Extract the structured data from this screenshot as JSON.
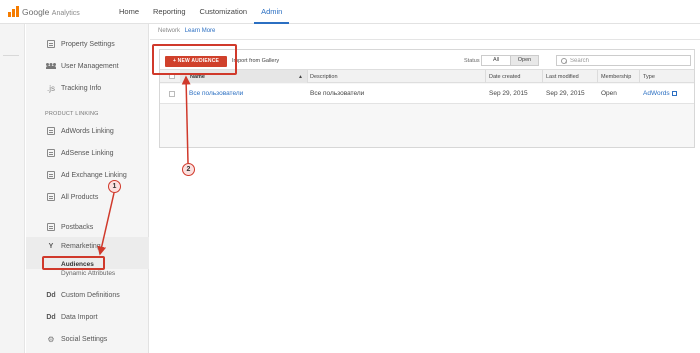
{
  "app": {
    "logo_brand": "Google",
    "logo_product": "Analytics"
  },
  "topnav": [
    "Home",
    "Reporting",
    "Customization",
    "Admin"
  ],
  "topnav_active": "Admin",
  "breadcrumb": {
    "text": "Network",
    "link": "Learn More"
  },
  "sidebar": {
    "items_top": [
      {
        "label": "Property Settings",
        "icon": "property-settings-icon"
      },
      {
        "label": "User Management",
        "icon": "users-icon"
      },
      {
        "label": "Tracking Info",
        "icon": "tracking-info-icon"
      }
    ],
    "section_label": "PRODUCT LINKING",
    "items_linking": [
      {
        "label": "AdWords Linking",
        "icon": "adwords-icon"
      },
      {
        "label": "AdSense Linking",
        "icon": "adsense-icon"
      },
      {
        "label": "Ad Exchange Linking",
        "icon": "ad-exchange-icon"
      },
      {
        "label": "All Products",
        "icon": "all-products-icon"
      }
    ],
    "postbacks": "Postbacks",
    "remarketing": "Remarketing",
    "remarketing_sub": [
      "Audiences",
      "Dynamic Attributes"
    ],
    "custom_definitions": {
      "label": "Custom Definitions",
      "icon_text": "Dd"
    },
    "data_import": {
      "label": "Data Import",
      "icon_text": "Dd"
    },
    "social_settings": "Social Settings"
  },
  "toolbar": {
    "new_audience": "+ NEW AUDIENCE",
    "import_gallery": "Import from Gallery",
    "status_label": "Status",
    "status_options": [
      "All",
      "Open"
    ],
    "status_selected": "Open",
    "search_placeholder": "Search"
  },
  "table": {
    "columns": [
      "Name",
      "Description",
      "Date created",
      "Last modified",
      "Membership",
      "Type"
    ],
    "sort_indicator": "▲",
    "rows": [
      {
        "name": "Все пользователи",
        "description": "Все пользователи",
        "date_created": "Sep 29, 2015",
        "last_modified": "Sep 29, 2015",
        "membership": "Open",
        "type": "AdWords"
      }
    ]
  },
  "annotations": {
    "step1": "1",
    "step2": "2"
  },
  "colors": {
    "accent_blue": "#2b6fc2",
    "button_red": "#d0402b",
    "annotation_red": "#d0392b"
  }
}
